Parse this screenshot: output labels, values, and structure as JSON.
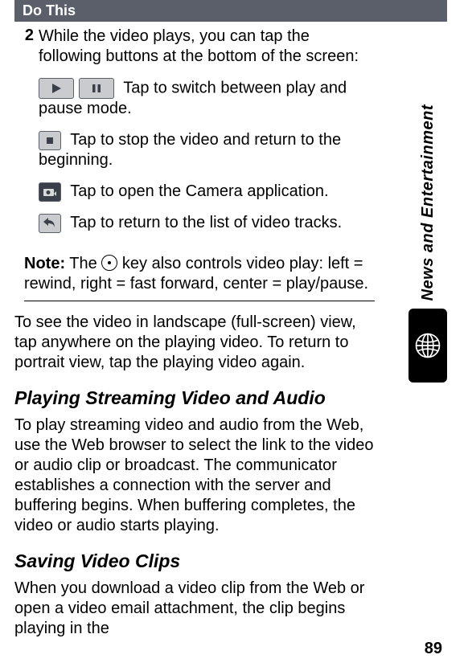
{
  "header": {
    "do_this": "Do This"
  },
  "step": {
    "number": "2",
    "intro": "While the video plays, you can tap the following buttons at the bottom of the screen:",
    "play_pause": "Tap to switch between play and pause mode.",
    "stop": "Tap to stop the video and return to the beginning.",
    "camera": "Tap to open the Camera application.",
    "return_list": "Tap to return to the list of video tracks."
  },
  "note": {
    "label": "Note:",
    "before": " The ",
    "after": " key also controls video play: left = rewind, right = fast forward, center = play/pause."
  },
  "landscape_text": "To see the video in landscape (full-screen) view, tap anywhere on the playing video. To return to portrait view, tap the playing video again.",
  "streaming": {
    "heading": "Playing Streaming Video and Audio",
    "body": "To play streaming video and audio from the Web, use the Web browser to select the link to the video or audio clip or broadcast. The communicator establishes a connection with the server and buffering begins. When buffering completes, the video or audio starts playing."
  },
  "saving": {
    "heading": "Saving Video Clips",
    "body": "When you download a video clip from the Web or open a video email attachment, the clip begins playing in the"
  },
  "sidebar": {
    "label": "News and Entertainment"
  },
  "page_number": "89"
}
